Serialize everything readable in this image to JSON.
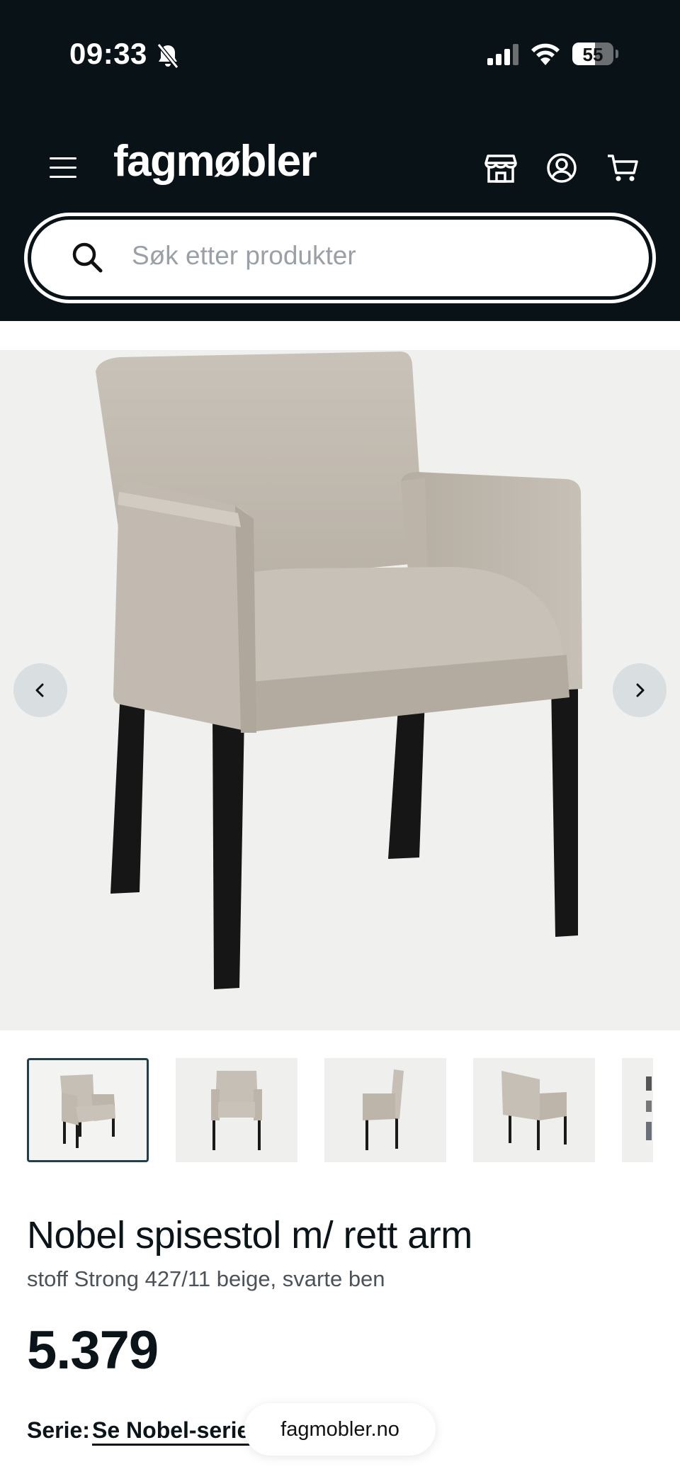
{
  "status_bar": {
    "time": "09:33",
    "battery": "55",
    "battery_level": 0.55
  },
  "header": {
    "logo": "fagmøbler",
    "icons": [
      "menu-icon",
      "store-icon",
      "account-icon",
      "cart-icon"
    ]
  },
  "search": {
    "placeholder": "Søk etter produkter",
    "value": ""
  },
  "gallery": {
    "prev_icon": "chevron-left-icon",
    "next_icon": "chevron-right-icon",
    "thumbnails": [
      "front-three-quarter",
      "front",
      "side",
      "back-three-quarter",
      "detail"
    ]
  },
  "product": {
    "title": "Nobel spisestol m/ rett arm",
    "subtitle": "stoff Strong 427/11 beige, svarte ben",
    "price": "5.379",
    "serie_label": "Serie:",
    "serie_link": "Se Nobel-serie"
  },
  "browser": {
    "url": "fagmobler.no"
  },
  "colors": {
    "header_bg": "#091317",
    "accent": "#23404a",
    "fabric": "#c4bcb1",
    "legs": "#161616"
  }
}
